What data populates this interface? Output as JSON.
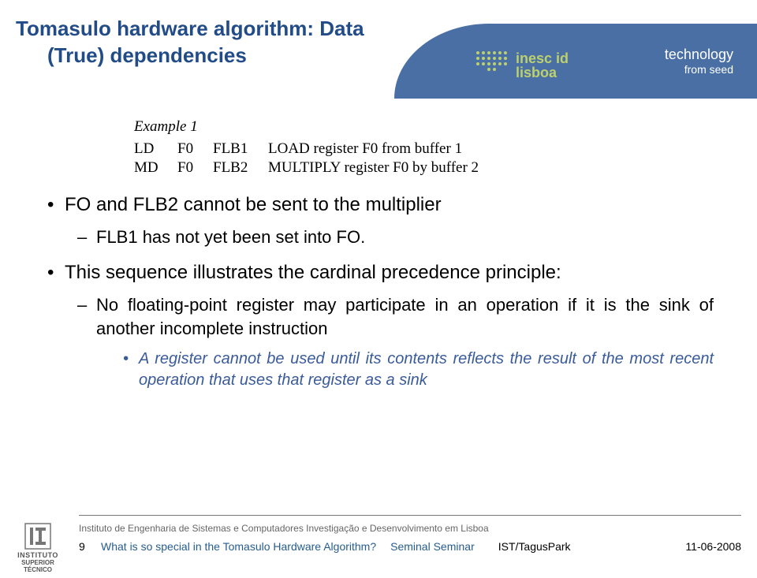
{
  "header": {
    "title_line1": "Tomasulo hardware algorithm: Data",
    "title_line2": "(True) dependencies",
    "brand_name": "inesc id",
    "brand_sub": "lisboa",
    "tag_top": "technology",
    "tag_bot": "from seed"
  },
  "example": {
    "title": "Example 1",
    "rows": [
      {
        "op": "LD",
        "reg": "F0",
        "buf": "FLB1",
        "desc": "LOAD register F0 from buffer 1"
      },
      {
        "op": "MD",
        "reg": "F0",
        "buf": "FLB2",
        "desc": "MULTIPLY register F0 by buffer 2"
      }
    ]
  },
  "bullets": [
    {
      "text": "FO and FLB2 cannot be sent to the multiplier",
      "sub": [
        {
          "text": "FLB1 has not yet been set into FO."
        }
      ]
    },
    {
      "text": "This sequence illustrates the cardinal precedence principle:",
      "sub": [
        {
          "text": "No floating-point register may participate in an operation if it is the sink of another incomplete instruction",
          "sub3": [
            {
              "text": "A register cannot be used until its contents reflects the result of the most recent operation that uses that register as a sink"
            }
          ]
        }
      ]
    }
  ],
  "footer": {
    "institute": "Instituto de Engenharia de Sistemas e Computadores Investigação e Desenvolvimento em Lisboa",
    "page": "9",
    "talk": "What is so special in the Tomasulo Hardware Algorithm?",
    "seminar": "Seminal Seminar",
    "location": "IST/TagusPark",
    "date": "11-06-2008",
    "logo_l1": "INSTITUTO",
    "logo_l2": "SUPERIOR",
    "logo_l3": "TÉCNICO"
  }
}
